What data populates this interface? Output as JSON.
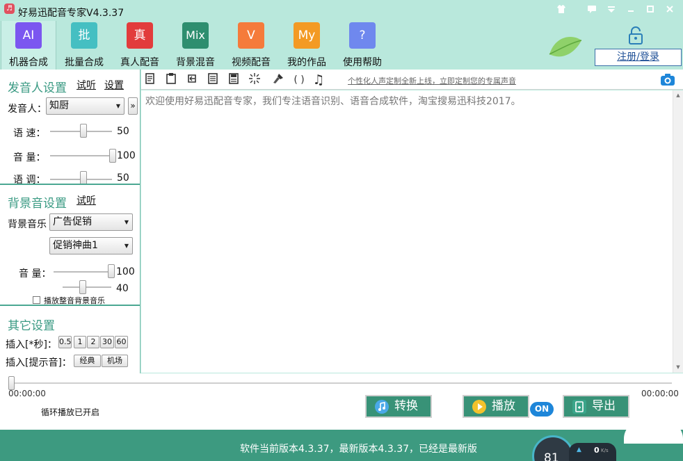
{
  "window": {
    "title": "好易迅配音专家V4.3.37",
    "icon_glyph": "♬",
    "controls": [
      "shirt-icon",
      "message-icon",
      "menu-icon",
      "minimize-icon",
      "maximize-icon",
      "close-icon"
    ]
  },
  "toolbar": {
    "items": [
      {
        "tile": "AI",
        "label": "机器合成",
        "color": "#7b56f0"
      },
      {
        "tile": "批",
        "label": "批量合成",
        "color": "#45bfc2"
      },
      {
        "tile": "真",
        "label": "真人配音",
        "color": "#e23c3c"
      },
      {
        "tile": "Mix",
        "label": "背景混音",
        "color": "#2e8e6f"
      },
      {
        "tile": "V",
        "label": "视频配音",
        "color": "#f57b3b"
      },
      {
        "tile": "My",
        "label": "我的作品",
        "color": "#f39a24"
      },
      {
        "tile": "?",
        "label": "使用帮助",
        "color": "#6f88ee"
      }
    ],
    "register_label": "注册/登录"
  },
  "speaker": {
    "title": "发音人设置",
    "listen": "试听",
    "settings": "设置",
    "speaker_label": "发音人：",
    "speaker_value": "知厨",
    "more_glyph": "»",
    "speed_label": "语 速：",
    "speed_value": "50",
    "speed_level": 0.5,
    "volume_label": "音 量：",
    "volume_value": "100",
    "volume_level": 1.0,
    "pitch_label": "语 调：",
    "pitch_value": "50",
    "pitch_level": 0.5
  },
  "bgm": {
    "title": "背景音设置",
    "listen": "试听",
    "music_label": "背景音乐",
    "category_value": "广告促销",
    "track_value": "促销神曲1",
    "volume_label": "音 量：",
    "volume_value": "100",
    "volume_level": 1.0,
    "volume2_value": "40",
    "volume2_level": 0.4,
    "checkbox_label": "播放整音背景音乐"
  },
  "other": {
    "title": "其它设置",
    "insert_sec_label": "插入[*秒]：",
    "insert_sec_buttons": [
      "0.5",
      "1",
      "2",
      "30",
      "60"
    ],
    "insert_tone_label": "插入[提示音]：",
    "tone_buttons": [
      "经典",
      "机场"
    ]
  },
  "editor": {
    "tools": [
      "☰",
      "❐",
      "↶",
      "☷",
      "▤",
      "✳",
      "✎",
      "( )",
      "♫"
    ],
    "promo": "个性化人声定制全新上线，立即定制您的专属声音",
    "text": "欢迎使用好易迅配音专家，我们专注语音识别、语音合成软件，淘宝搜易迅科技2017。"
  },
  "player": {
    "time_start": "00:00:00",
    "time_end": "00:00:00",
    "progress": 0.0,
    "loop_status": "循环播放已开启",
    "convert_label": "转换",
    "play_label": "播放",
    "on_badge": "ON",
    "export_label": "导出"
  },
  "status": {
    "version_text": "软件当前版本4.3.37，最新版本4.3.37，已经是最新版",
    "gauge_value": "81",
    "net_speed": "0",
    "net_unit": "K/s"
  },
  "colors": {
    "accent": "#3d9a80",
    "header_bg": "#b9e8dc",
    "section_title": "#3a9a83"
  }
}
